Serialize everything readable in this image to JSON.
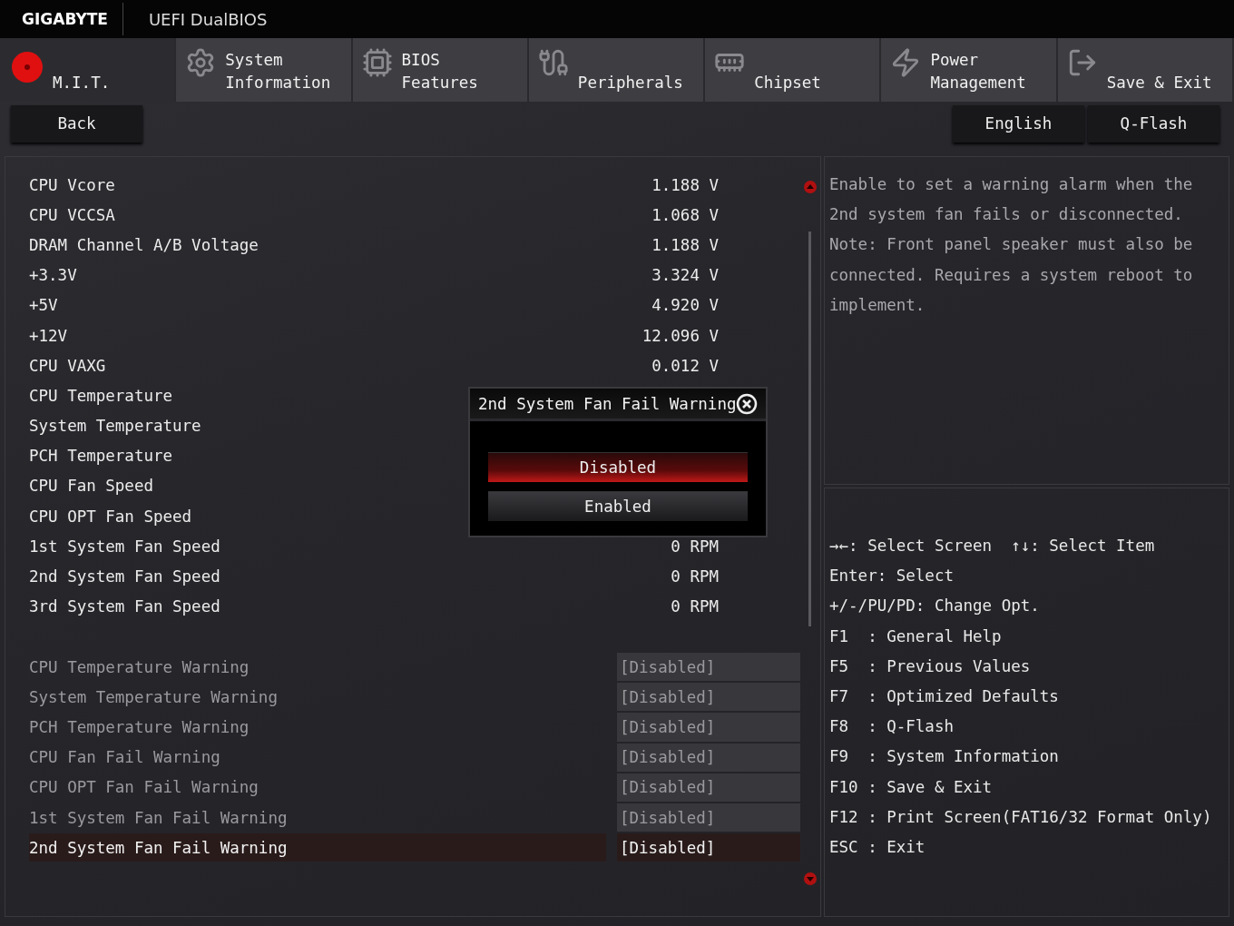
{
  "header": {
    "brand": "GIGABYTE",
    "title": "UEFI DualBIOS"
  },
  "tabs": [
    {
      "label": "M.I.T.",
      "selected": true
    },
    {
      "label": "System\nInformation",
      "selected": false
    },
    {
      "label": "BIOS\nFeatures",
      "selected": false
    },
    {
      "label": "Peripherals",
      "selected": false
    },
    {
      "label": "Chipset",
      "selected": false
    },
    {
      "label": "Power\nManagement",
      "selected": false
    },
    {
      "label": "Save & Exit",
      "selected": false
    }
  ],
  "back_button": "Back",
  "language_button": "English",
  "qflash_button": "Q-Flash",
  "readings": [
    {
      "name": "CPU Vcore",
      "value": "1.188 V"
    },
    {
      "name": "CPU VCCSA",
      "value": "1.068 V"
    },
    {
      "name": "DRAM Channel A/B Voltage",
      "value": "1.188 V"
    },
    {
      "name": "+3.3V",
      "value": "3.324 V"
    },
    {
      "name": "+5V",
      "value": "4.920 V"
    },
    {
      "name": "+12V",
      "value": "12.096 V"
    },
    {
      "name": "CPU VAXG",
      "value": "0.012 V"
    },
    {
      "name": "CPU Temperature"
    },
    {
      "name": "System Temperature"
    },
    {
      "name": "PCH Temperature"
    },
    {
      "name": "CPU Fan Speed"
    },
    {
      "name": "CPU OPT Fan Speed"
    },
    {
      "name": "1st System Fan Speed",
      "value": "0 RPM"
    },
    {
      "name": "2nd System Fan Speed",
      "value": "0 RPM"
    },
    {
      "name": "3rd System Fan Speed",
      "value": "0 RPM"
    }
  ],
  "settings": [
    {
      "name": "CPU Temperature Warning",
      "value": "[Disabled]",
      "selected": false
    },
    {
      "name": "System Temperature Warning",
      "value": "[Disabled]",
      "selected": false
    },
    {
      "name": "PCH Temperature Warning",
      "value": "[Disabled]",
      "selected": false
    },
    {
      "name": "CPU Fan Fail Warning",
      "value": "[Disabled]",
      "selected": false
    },
    {
      "name": "CPU OPT Fan Fail Warning",
      "value": "[Disabled]",
      "selected": false
    },
    {
      "name": "1st System Fan Fail Warning",
      "value": "[Disabled]",
      "selected": false
    },
    {
      "name": "2nd System Fan Fail Warning",
      "value": "[Disabled]",
      "selected": true
    }
  ],
  "popup": {
    "title": "2nd System Fan Fail Warning",
    "options": [
      {
        "label": "Disabled",
        "selected": true
      },
      {
        "label": "Enabled",
        "selected": false
      }
    ]
  },
  "help": {
    "description": "Enable to set a warning alarm when the 2nd system fan fails or disconnected. Note: Front panel speaker must also be connected. Requires a system reboot to implement.",
    "keys": [
      "→←: Select Screen  ↑↓: Select Item",
      "Enter: Select",
      "+/-/PU/PD: Change Opt.",
      "F1  : General Help",
      "F5  : Previous Values",
      "F7  : Optimized Defaults",
      "F8  : Q-Flash",
      "F9  : System Information",
      "F10 : Save & Exit",
      "F12 : Print Screen(FAT16/32 Format Only)",
      "ESC : Exit"
    ]
  }
}
